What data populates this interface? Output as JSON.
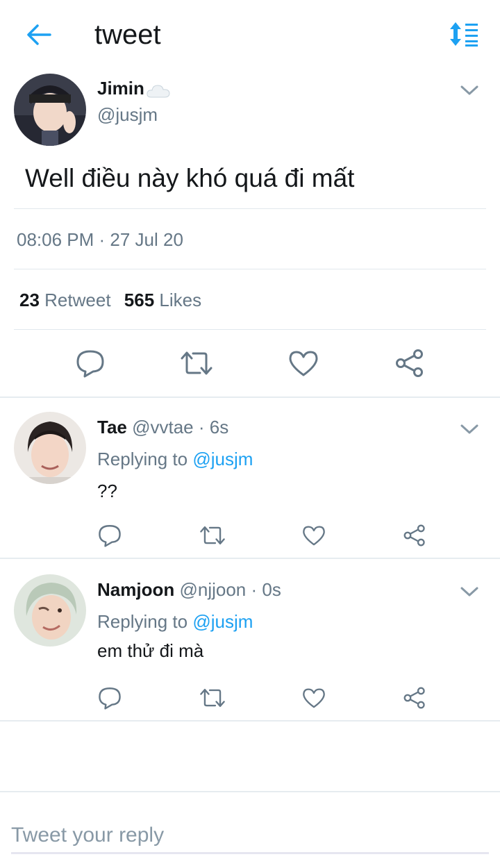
{
  "header": {
    "title": "tweet",
    "back_icon": "arrow-left-icon",
    "sort_icon": "sort-icon",
    "accent_color": "#1da1f2"
  },
  "main_tweet": {
    "name": "Jimin",
    "name_emoji": "cloud-icon",
    "handle": "@jusjm",
    "text": "Well điều này khó quá đi mất",
    "timestamp": "08:06 PM · 27 Jul 20",
    "retweet_count": "23",
    "retweet_label": "Retweet",
    "like_count": "565",
    "like_label": "Likes"
  },
  "replies": [
    {
      "name": "Tae",
      "handle": "@vvtae",
      "time": "· 6s",
      "replying_label": "Replying to",
      "replying_to": "@jusjm",
      "text": "??"
    },
    {
      "name": "Namjoon",
      "handle": "@njjoon",
      "time": "· 0s",
      "replying_label": "Replying to",
      "replying_to": "@jusjm",
      "text": "em thử đi mà"
    }
  ],
  "compose": {
    "placeholder": "Tweet your reply"
  }
}
